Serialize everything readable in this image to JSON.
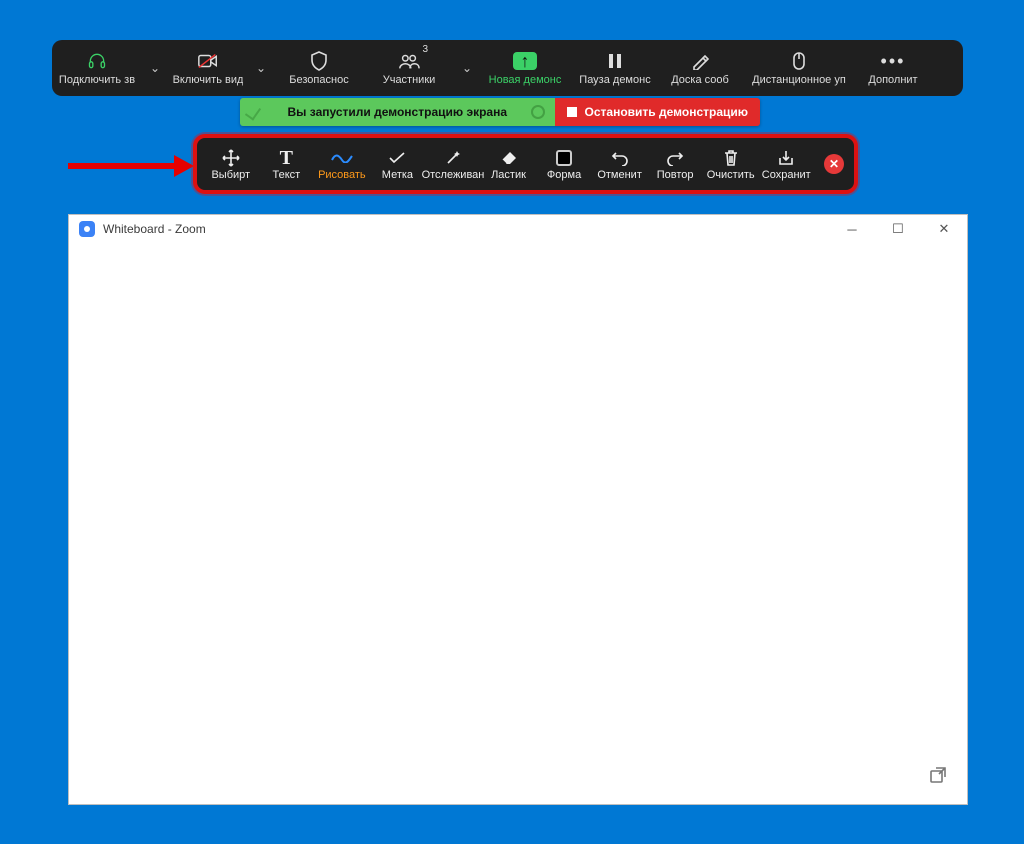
{
  "main_toolbar": {
    "items": [
      {
        "label": "Подключить зв"
      },
      {
        "label": "Включить вид"
      },
      {
        "label": "Безопаснос"
      },
      {
        "label": "Участники",
        "badge": "3"
      },
      {
        "label": "Новая демонс",
        "highlight": true
      },
      {
        "label": "Пауза демонс"
      },
      {
        "label": "Доска сооб"
      },
      {
        "label": "Дистанционное уп"
      },
      {
        "label": "Дополнит"
      }
    ]
  },
  "notification": {
    "message": "Вы запустили демонстрацию экрана",
    "stop_label": "Остановить демонстрацию"
  },
  "annotation_toolbar": {
    "items": [
      {
        "label": "Выбирт"
      },
      {
        "label": "Текст"
      },
      {
        "label": "Рисовать",
        "active": true
      },
      {
        "label": "Метка"
      },
      {
        "label": "Отслеживан"
      },
      {
        "label": "Ластик"
      },
      {
        "label": "Форма"
      },
      {
        "label": "Отменит"
      },
      {
        "label": "Повтор"
      },
      {
        "label": "Очистить"
      },
      {
        "label": "Сохранит"
      }
    ]
  },
  "whiteboard": {
    "title": "Whiteboard - Zoom"
  }
}
